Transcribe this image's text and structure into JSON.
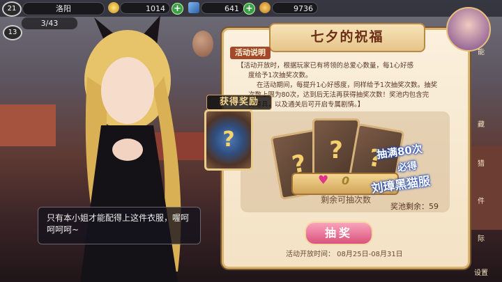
{
  "top_bar": {
    "level": "21",
    "city": "洛阳",
    "currency1": "1014",
    "currency2": "641",
    "currency3": "9736",
    "stamina": "3/43",
    "vip": "13"
  },
  "dialogue": {
    "text": "只有本小姐才能配得上这件衣服，喔呵呵呵呵~"
  },
  "event": {
    "title": "七夕的祝福",
    "rules_tag": "活动说明",
    "rule_line1": "【活动开放时，根据玩家已有将领的总爱心数量，每1心好感",
    "rule_line2": "度给予1次抽奖次数。",
    "rule_line3": "在活动期间，每提升1心好感度，同样给予1次抽奖次数。抽奖",
    "rule_line4": "次数上限为80次，达到后无法再获得抽奖次数！奖池内包含完",
    "rule_line5": "美道具，以及通关后可开启专属剧情。】",
    "remaining_count": "0",
    "remaining_label": "剩余可抽次数",
    "promo_line1": "抽满80次",
    "promo_line2": "必得",
    "promo_line3": "刘璋黑猫服",
    "pool_label": "奖池剩余：59",
    "draw_button": "抽奖",
    "period": "活动开放时间：  08月25日-08月31日"
  },
  "reward_popup": {
    "title": "获得奖励"
  },
  "side_menu": {
    "item1": "能",
    "item2": "藏",
    "item3": "猎",
    "item4": "件",
    "item5": "际",
    "item6": "设置"
  },
  "icons": {
    "plus": "plus-icon",
    "coin": "gold-coin-icon",
    "card": "question-card-icon",
    "heart": "heart-icon"
  },
  "colors": {
    "panel_bg": "#f7e8cc",
    "accent": "#a44a2a",
    "button_pink": "#e46d92",
    "plus_green": "#3aa048"
  }
}
